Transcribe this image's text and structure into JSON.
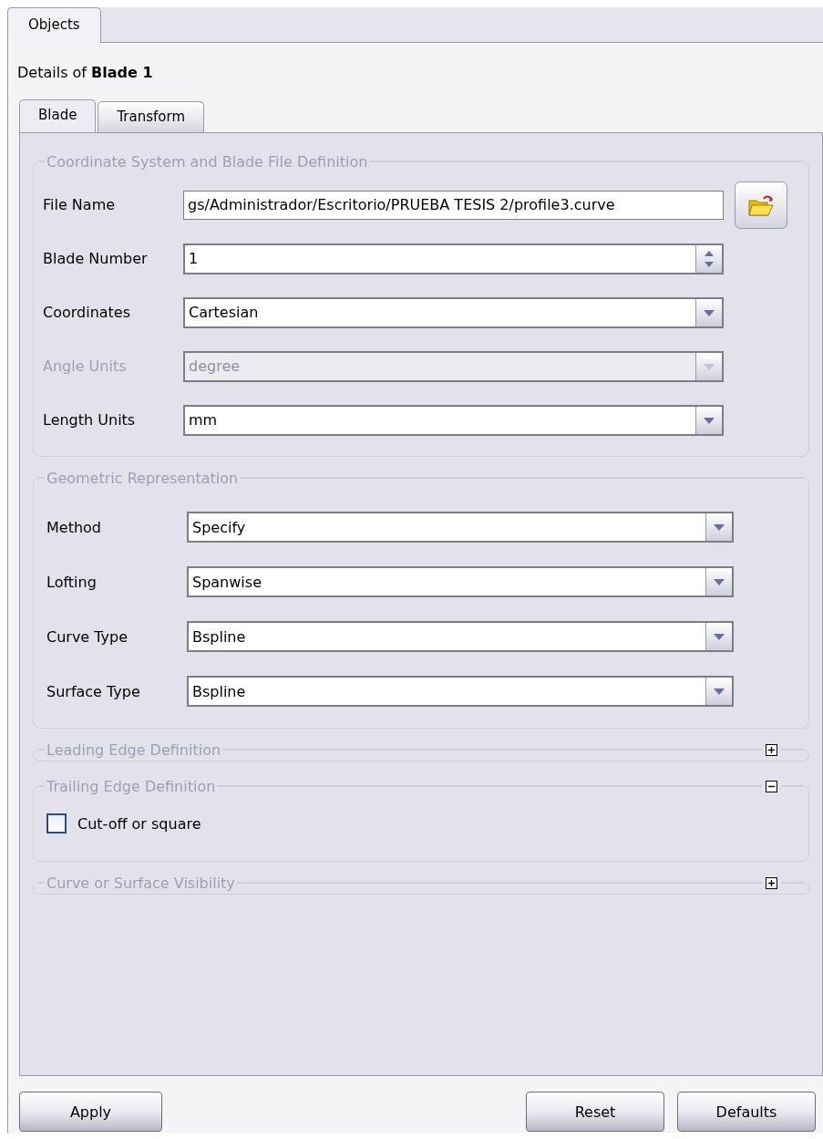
{
  "outer_tabs": [
    {
      "label": "Objects",
      "selected": true
    }
  ],
  "details": "Details of **Blade 1**",
  "tabs": [
    {
      "label": "Blade",
      "selected": true
    },
    {
      "label": "Transform",
      "selected": false
    }
  ],
  "sections": [
    {
      "title": "Coordinate System and Blade File Definition",
      "fields": [
        {
          "kind": "file",
          "label": "File Name",
          "value": "gs/Administrador/Escritorio/PRUEBA TESIS 2/profile3.curve",
          "disabled": false
        },
        {
          "kind": "spin",
          "label": "Blade Number",
          "value": "1",
          "disabled": false
        },
        {
          "kind": "select",
          "label": "Coordinates",
          "value": "Cartesian",
          "disabled": false
        },
        {
          "kind": "select",
          "label": "Angle Units",
          "value": "degree",
          "disabled": true
        },
        {
          "kind": "select",
          "label": "Length Units",
          "value": "mm",
          "disabled": false
        }
      ]
    },
    {
      "title": "Geometric Representation",
      "fields": [
        {
          "kind": "select",
          "label": "Method",
          "value": "Specify",
          "disabled": false
        },
        {
          "kind": "select",
          "label": "Lofting",
          "value": "Spanwise",
          "disabled": false
        },
        {
          "kind": "select",
          "label": "Curve Type",
          "value": "Bspline",
          "disabled": false
        },
        {
          "kind": "select",
          "label": "Surface Type",
          "value": "Bspline",
          "disabled": false
        }
      ]
    },
    {
      "title": "Leading Edge Definition",
      "expanded": false
    },
    {
      "title": "Trailing Edge Definition",
      "expanded": true,
      "fields": [
        {
          "kind": "checkbox",
          "label": "Cut-off or square",
          "checked": false
        }
      ]
    },
    {
      "title": "Curve or Surface Visibility",
      "expanded": false
    }
  ],
  "buttons_left": [
    "Apply"
  ],
  "buttons_right": [
    "Reset",
    "Defaults"
  ]
}
